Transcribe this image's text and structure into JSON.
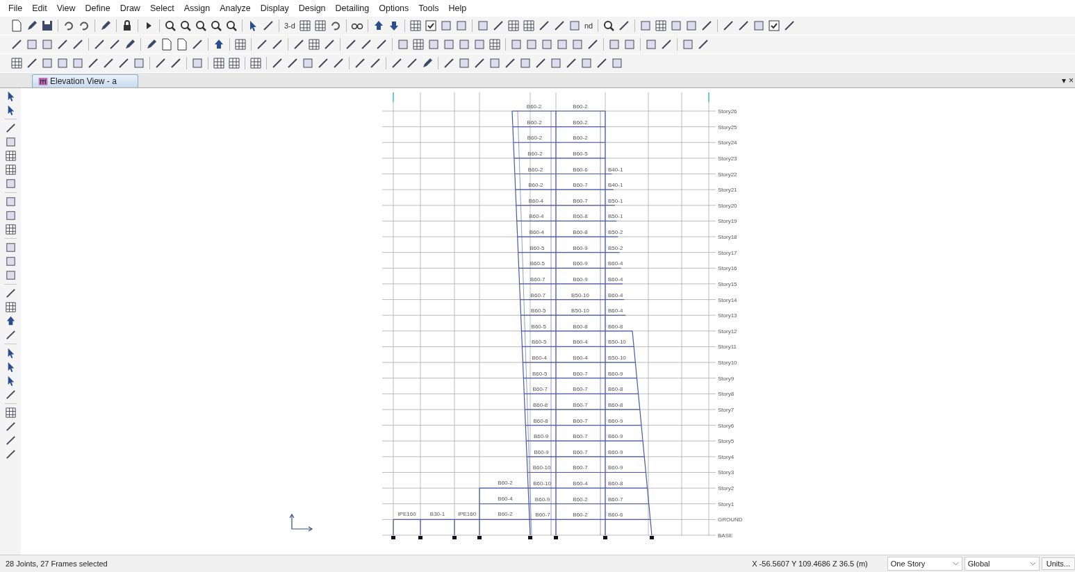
{
  "menu": [
    "File",
    "Edit",
    "View",
    "Define",
    "Draw",
    "Select",
    "Assign",
    "Analyze",
    "Display",
    "Design",
    "Detailing",
    "Options",
    "Tools",
    "Help"
  ],
  "toolbar_texts": [
    "3-d",
    "nd"
  ],
  "tab": {
    "label": "Elevation View - a",
    "selected": true
  },
  "window_controls": [
    "▾",
    "×"
  ],
  "stories": [
    {
      "name": "Story26",
      "beams": [
        "B60-2",
        "B60-2"
      ]
    },
    {
      "name": "Story25",
      "beams": [
        "B60-2",
        "B60-2"
      ]
    },
    {
      "name": "Story24",
      "beams": [
        "B60-2",
        "B60-2"
      ]
    },
    {
      "name": "Story23",
      "beams": [
        "B60-2",
        "B60-5"
      ]
    },
    {
      "name": "Story22",
      "beams": [
        "B60-2",
        "B60-6",
        "B40-1"
      ]
    },
    {
      "name": "Story21",
      "beams": [
        "B60-2",
        "B60-7",
        "B40-1"
      ]
    },
    {
      "name": "Story20",
      "beams": [
        "B60-4",
        "B60-7",
        "B50-1"
      ]
    },
    {
      "name": "Story19",
      "beams": [
        "B60-4",
        "B60-8",
        "B50-1"
      ]
    },
    {
      "name": "Story18",
      "beams": [
        "B60-4",
        "B60-8",
        "B50-2"
      ]
    },
    {
      "name": "Story17",
      "beams": [
        "B60-5",
        "B60-9",
        "B50-2"
      ]
    },
    {
      "name": "Story16",
      "beams": [
        "B60-5",
        "B60-9",
        "B60-4"
      ]
    },
    {
      "name": "Story15",
      "beams": [
        "B60-7",
        "B60-9",
        "B60-4"
      ]
    },
    {
      "name": "Story14",
      "beams": [
        "B60-7",
        "B50-10",
        "B60-4"
      ]
    },
    {
      "name": "Story13",
      "beams": [
        "B60-5",
        "B50-10",
        "B60-4"
      ]
    },
    {
      "name": "Story12",
      "beams": [
        "B60-5",
        "B60-8",
        "B60-8"
      ]
    },
    {
      "name": "Story11",
      "beams": [
        "B60-5",
        "B60-4",
        "B50-10"
      ]
    },
    {
      "name": "Story10",
      "beams": [
        "B60-4",
        "B60-4",
        "B50-10"
      ]
    },
    {
      "name": "Story9",
      "beams": [
        "B60-5",
        "B60-7",
        "B60-9"
      ]
    },
    {
      "name": "Story8",
      "beams": [
        "B60-7",
        "B60-7",
        "B60-8"
      ]
    },
    {
      "name": "Story7",
      "beams": [
        "B60-8",
        "B60-7",
        "B60-8"
      ]
    },
    {
      "name": "Story6",
      "beams": [
        "B60-8",
        "B60-7",
        "B60-9"
      ]
    },
    {
      "name": "Story5",
      "beams": [
        "B60-9",
        "B60-7",
        "B60-9"
      ]
    },
    {
      "name": "Story4",
      "beams": [
        "B60-9",
        "B60-7",
        "B60-9"
      ]
    },
    {
      "name": "Story3",
      "beams": [
        "B60-10",
        "B60-7",
        "B60-9"
      ]
    },
    {
      "name": "Story2",
      "beams": [
        "B60-10",
        "B60-4",
        "B60-8"
      ],
      "annex_beam": "B60-2"
    },
    {
      "name": "Story1",
      "beams": [
        "B60-9",
        "B60-2",
        "B60-7"
      ],
      "annex_beam": "B60-4"
    },
    {
      "name": "GROUND",
      "beams": [
        "B60-7",
        "B60-2",
        "B60-6"
      ],
      "annex_beam": "B60-2",
      "podium_beams": [
        "IPE160",
        "B30-1",
        "IPE160"
      ]
    },
    {
      "name": "BASE"
    }
  ],
  "status_bar": {
    "selection": "28 Joints, 27 Frames selected",
    "coordinates": "X -56.5607  Y 109.4686  Z 36.5 (m)",
    "dropdowns": [
      "One Story",
      "Global"
    ],
    "button": "Units..."
  }
}
